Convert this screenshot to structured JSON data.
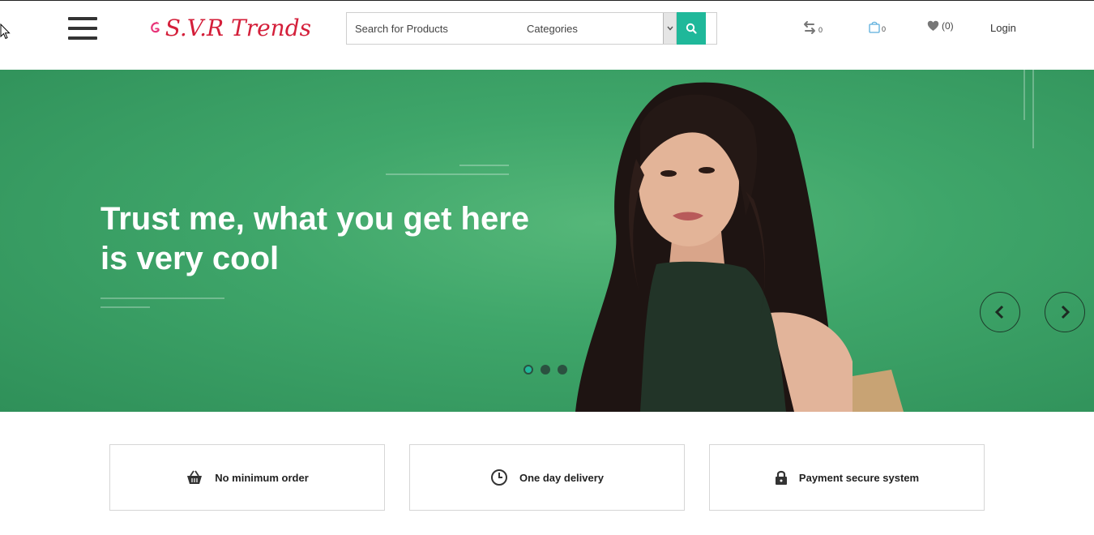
{
  "header": {
    "logo_text": "S.V.R Trends",
    "search": {
      "placeholder": "Search for Products",
      "category_label": "Categories"
    },
    "compare_count": "0",
    "cart_count": "0",
    "wishlist_count": "(0)",
    "login_label": "Login"
  },
  "hero": {
    "heading": "Trust me, what you get here is very cool",
    "slide_count": 3,
    "active_slide": 1
  },
  "features": [
    {
      "icon": "basket-icon",
      "label": "No minimum order"
    },
    {
      "icon": "clock-icon",
      "label": "One day delivery"
    },
    {
      "icon": "lock-icon",
      "label": "Payment secure system"
    }
  ],
  "colors": {
    "accent": "#1fb89a",
    "hero_green": "#3fa66a",
    "logo_red": "#d41f3a",
    "logo_pink": "#e8357a"
  }
}
